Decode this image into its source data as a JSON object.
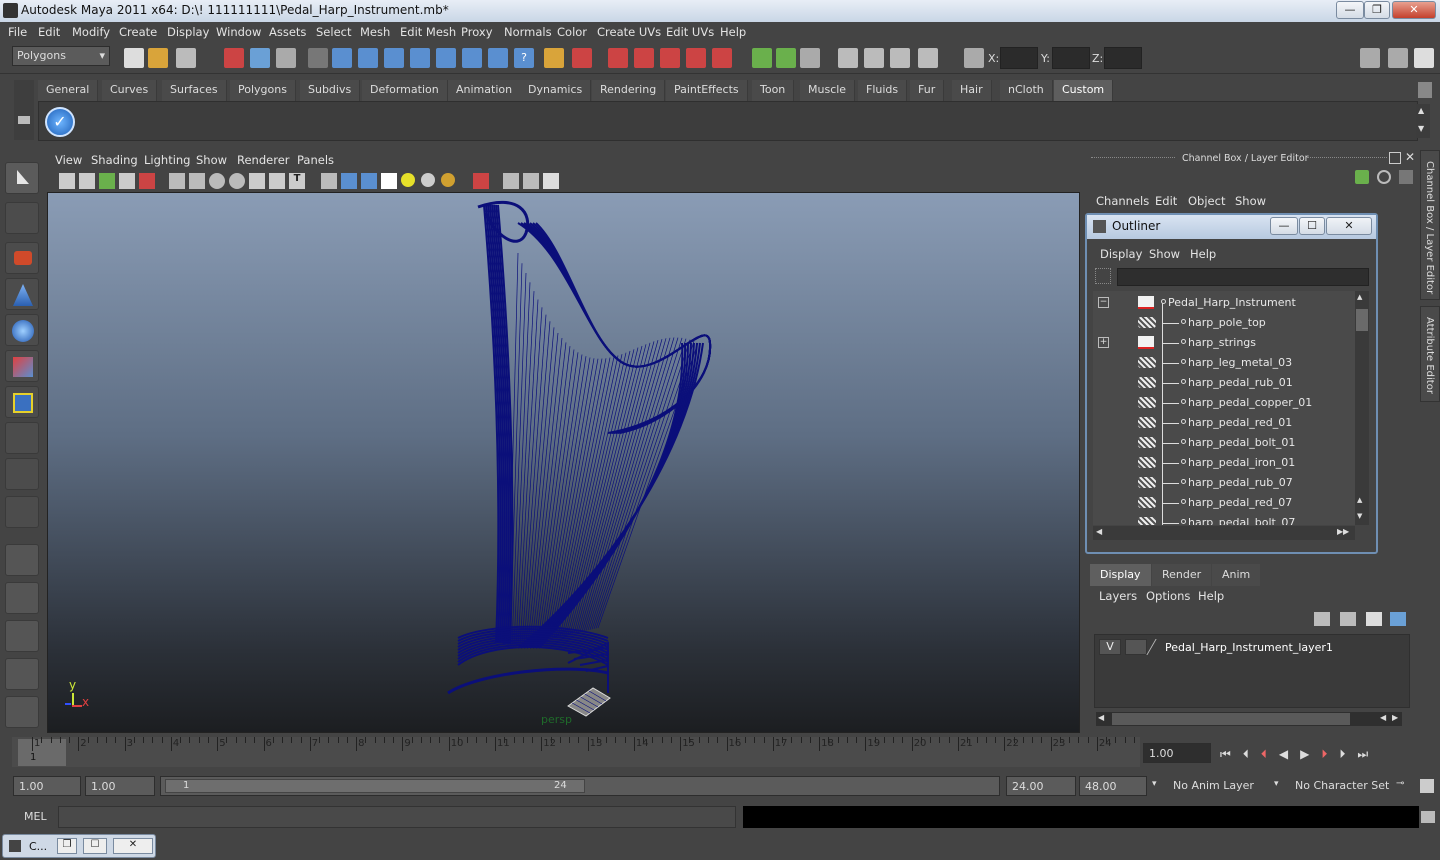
{
  "window": {
    "title": "Autodesk Maya 2011 x64: D:\\! 111111111\\Pedal_Harp_Instrument.mb*",
    "min": "—",
    "max": "❐",
    "close": "✕"
  },
  "menubar": [
    "File",
    "Edit",
    "Modify",
    "Create",
    "Display",
    "Window",
    "Assets",
    "Select",
    "Mesh",
    "Edit Mesh",
    "Proxy",
    "Normals",
    "Color",
    "Create UVs",
    "Edit UVs",
    "Help"
  ],
  "statusline": {
    "mode": "Polygons",
    "x_label": "X:",
    "y_label": "Y:",
    "z_label": "Z:"
  },
  "shelf_tabs": [
    "General",
    "Curves",
    "Surfaces",
    "Polygons",
    "Subdivs",
    "Deformation",
    "Animation",
    "Dynamics",
    "Rendering",
    "PaintEffects",
    "Toon",
    "Muscle",
    "Fluids",
    "Fur",
    "Hair",
    "nCloth",
    "Custom"
  ],
  "shelf_active": "Custom",
  "viewport": {
    "menus": [
      "View",
      "Shading",
      "Lighting",
      "Show",
      "Renderer",
      "Panels"
    ],
    "camera_label": "persp",
    "axis_y": "y",
    "axis_x": "x",
    "wire_color": "#0b0f7a"
  },
  "channelbox": {
    "title": "Channel Box / Layer Editor",
    "menus": [
      "Channels",
      "Edit",
      "Object",
      "Show"
    ],
    "side_tab_1": "Channel Box / Layer Editor",
    "side_tab_2": "Attribute Editor"
  },
  "outliner": {
    "title": "Outliner",
    "menus": [
      "Display",
      "Show",
      "Help"
    ],
    "items": [
      {
        "name": "Pedal_Harp_Instrument",
        "expander": "−",
        "type": "group"
      },
      {
        "name": "harp_pole_top",
        "expander": "",
        "type": "mesh"
      },
      {
        "name": "harp_strings",
        "expander": "+",
        "type": "group"
      },
      {
        "name": "harp_leg_metal_03",
        "expander": "",
        "type": "mesh"
      },
      {
        "name": "harp_pedal_rub_01",
        "expander": "",
        "type": "mesh"
      },
      {
        "name": "harp_pedal_copper_01",
        "expander": "",
        "type": "mesh"
      },
      {
        "name": "harp_pedal_red_01",
        "expander": "",
        "type": "mesh"
      },
      {
        "name": "harp_pedal_bolt_01",
        "expander": "",
        "type": "mesh"
      },
      {
        "name": "harp_pedal_iron_01",
        "expander": "",
        "type": "mesh"
      },
      {
        "name": "harp_pedal_rub_07",
        "expander": "",
        "type": "mesh"
      },
      {
        "name": "harp_pedal_red_07",
        "expander": "",
        "type": "mesh"
      },
      {
        "name": "harp_pedal_bolt_07",
        "expander": "",
        "type": "mesh"
      }
    ]
  },
  "layers": {
    "tabs": [
      "Display",
      "Render",
      "Anim"
    ],
    "active_tab": "Display",
    "menus": [
      "Layers",
      "Options",
      "Help"
    ],
    "visibility": "V",
    "layer_name": "Pedal_Harp_Instrument_layer1"
  },
  "timeline": {
    "ticks": [
      "1",
      "2",
      "3",
      "4",
      "5",
      "6",
      "7",
      "8",
      "9",
      "10",
      "11",
      "12",
      "13",
      "14",
      "15",
      "16",
      "17",
      "18",
      "19",
      "20",
      "21",
      "22",
      "23",
      "24"
    ],
    "current_frame": "1",
    "current_time": "1.00"
  },
  "range": {
    "start_time": "1.00",
    "playback_start": "1.00",
    "slider_start": "1",
    "slider_end": "24",
    "playback_end": "24.00",
    "end_time": "48.00",
    "anim_layer": "No Anim Layer",
    "character_set": "No Character Set"
  },
  "mel": {
    "label": "MEL"
  },
  "taskbar": {
    "item": "C..."
  }
}
